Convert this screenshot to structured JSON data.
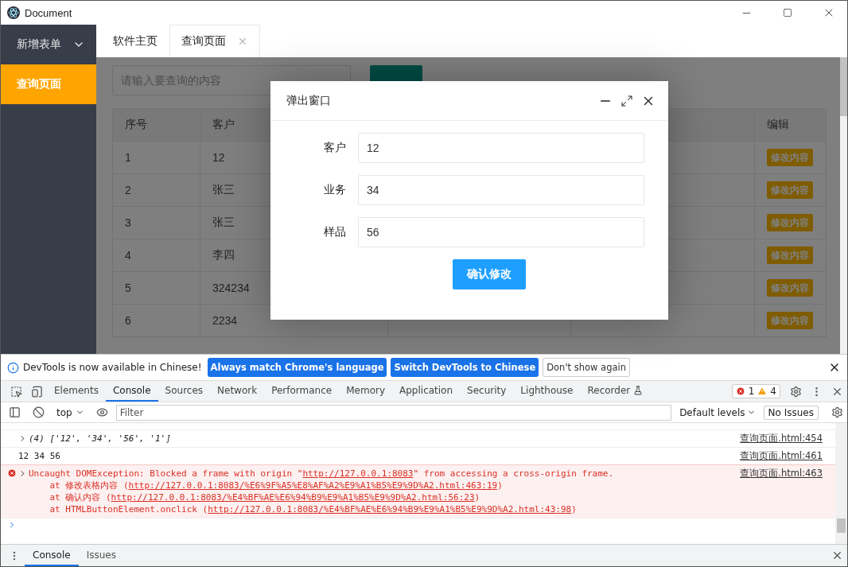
{
  "window": {
    "title": "Document"
  },
  "sidebar": {
    "items": [
      {
        "label": "新增表单",
        "kind": "group",
        "expanded": false,
        "selected": false
      },
      {
        "label": "查询页面",
        "kind": "item",
        "selected": true
      }
    ]
  },
  "tabs": [
    {
      "label": "软件主页",
      "selected": false,
      "closable": false
    },
    {
      "label": "查询页面",
      "selected": true,
      "closable": true
    }
  ],
  "search": {
    "placeholder": "请输入要查询的内容"
  },
  "table": {
    "headers": {
      "index": "序号",
      "customer": "客户",
      "edit": "编辑"
    },
    "rows": [
      {
        "index": "1",
        "customer": "12",
        "action": "修改内容"
      },
      {
        "index": "2",
        "customer": "张三",
        "action": "修改内容"
      },
      {
        "index": "3",
        "customer": "张三",
        "action": "修改内容"
      },
      {
        "index": "4",
        "customer": "李四",
        "action": "修改内容"
      },
      {
        "index": "5",
        "customer": "324234",
        "action": "修改内容"
      },
      {
        "index": "6",
        "customer": "2234",
        "action": "修改内容"
      }
    ]
  },
  "dialog": {
    "title": "弹出窗口",
    "fields": [
      {
        "label": "客户",
        "value": "12"
      },
      {
        "label": "业务",
        "value": "34"
      },
      {
        "label": "样品",
        "value": "56"
      }
    ],
    "submit": "确认修改"
  },
  "devtools": {
    "notice": {
      "text": "DevTools is now available in Chinese!",
      "buttons": [
        {
          "label": "Always match Chrome's language",
          "kind": "primary"
        },
        {
          "label": "Switch DevTools to Chinese",
          "kind": "primary"
        },
        {
          "label": "Don't show again",
          "kind": "plain"
        }
      ]
    },
    "panels": [
      {
        "label": "Elements",
        "selected": false
      },
      {
        "label": "Console",
        "selected": true
      },
      {
        "label": "Sources",
        "selected": false
      },
      {
        "label": "Network",
        "selected": false
      },
      {
        "label": "Performance",
        "selected": false
      },
      {
        "label": "Memory",
        "selected": false
      },
      {
        "label": "Application",
        "selected": false
      },
      {
        "label": "Security",
        "selected": false
      },
      {
        "label": "Lighthouse",
        "selected": false
      },
      {
        "label": "Recorder",
        "selected": false
      }
    ],
    "errors": "1",
    "warnings": "4",
    "context": "top",
    "filter_placeholder": "Filter",
    "levels": "Default levels",
    "issues": "No Issues",
    "messages": [
      {
        "kind": "array",
        "text": "(4) ['12', '34', '56', '1']",
        "source": "查询页面.html:454"
      },
      {
        "kind": "log",
        "text": "12 34 56",
        "source": "查询页面.html:461"
      },
      {
        "kind": "error",
        "before": "Uncaught DOMException: Blocked a frame with origin \"",
        "link": "http://127.0.0.1:8083",
        "after": "\" from accessing a cross-origin frame.",
        "source": "查询页面.html:463",
        "stack": [
          {
            "prefix": "at 修改表格内容 (",
            "url": "http://127.0.0.1:8083/%E6%9F%A5%E8%AF%A2%E9%A1%B5%E9%9D%A2.html:463:19",
            "suffix": ")"
          },
          {
            "prefix": "at 确认内容 (",
            "url": "http://127.0.0.1:8083/%E4%BF%AE%E6%94%B9%E9%A1%B5%E9%9D%A2.html:56:23",
            "suffix": ")"
          },
          {
            "prefix": "at HTMLButtonElement.onclick (",
            "url": "http://127.0.0.1:8083/%E4%BF%AE%E6%94%B9%E9%A1%B5%E9%9D%A2.html:43:98",
            "suffix": ")"
          }
        ]
      }
    ],
    "drawer_tabs": [
      {
        "label": "Console",
        "selected": true
      },
      {
        "label": "Issues",
        "selected": false
      }
    ]
  }
}
